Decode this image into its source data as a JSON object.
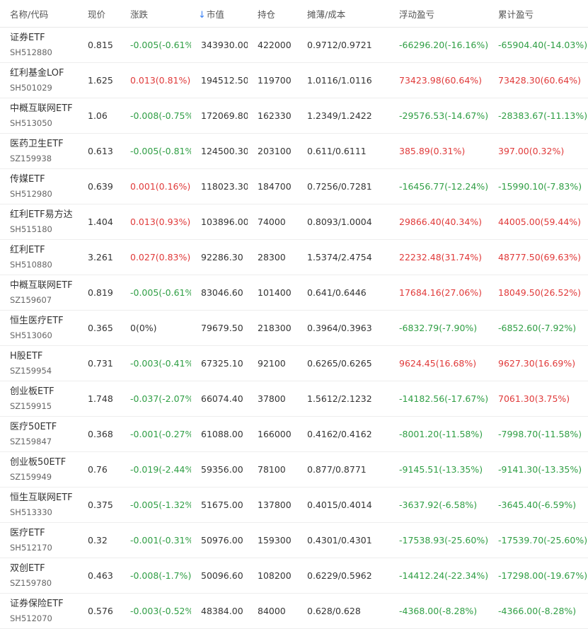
{
  "header": {
    "name": "名称/代码",
    "price": "现价",
    "change": "涨跌",
    "market_value": "市值",
    "market_value_sort_icon": "↓",
    "holding": "持仓",
    "cost": "摊薄/成本",
    "float_pl": "浮动盈亏",
    "total_pl": "累计盈亏"
  },
  "colors": {
    "up": "#e03a3a",
    "down": "#2f9e44",
    "sort_icon": "#3b82f6"
  },
  "rows": [
    {
      "name": "证券ETF",
      "code": "SH512880",
      "price": "0.815",
      "change": "-0.005(-0.61%)",
      "change_dir": "down",
      "market_value": "343930.00",
      "holding": "422000",
      "cost": "0.9712/0.9721",
      "float_pl": "-66296.20(-16.16%)",
      "float_dir": "down",
      "total_pl": "-65904.40(-14.03%)",
      "total_dir": "down"
    },
    {
      "name": "红利基金LOF",
      "code": "SH501029",
      "price": "1.625",
      "change": "0.013(0.81%)",
      "change_dir": "up",
      "market_value": "194512.50",
      "holding": "119700",
      "cost": "1.0116/1.0116",
      "float_pl": "73423.98(60.64%)",
      "float_dir": "up",
      "total_pl": "73428.30(60.64%)",
      "total_dir": "up"
    },
    {
      "name": "中概互联网ETF",
      "code": "SH513050",
      "price": "1.06",
      "change": "-0.008(-0.75%)",
      "change_dir": "down",
      "market_value": "172069.80",
      "holding": "162330",
      "cost": "1.2349/1.2422",
      "float_pl": "-29576.53(-14.67%)",
      "float_dir": "down",
      "total_pl": "-28383.67(-11.13%)",
      "total_dir": "down"
    },
    {
      "name": "医药卫生ETF",
      "code": "SZ159938",
      "price": "0.613",
      "change": "-0.005(-0.81%)",
      "change_dir": "down",
      "market_value": "124500.30",
      "holding": "203100",
      "cost": "0.611/0.6111",
      "float_pl": "385.89(0.31%)",
      "float_dir": "up",
      "total_pl": "397.00(0.32%)",
      "total_dir": "up"
    },
    {
      "name": "传媒ETF",
      "code": "SH512980",
      "price": "0.639",
      "change": "0.001(0.16%)",
      "change_dir": "up",
      "market_value": "118023.30",
      "holding": "184700",
      "cost": "0.7256/0.7281",
      "float_pl": "-16456.77(-12.24%)",
      "float_dir": "down",
      "total_pl": "-15990.10(-7.83%)",
      "total_dir": "down"
    },
    {
      "name": "红利ETF易方达",
      "code": "SH515180",
      "price": "1.404",
      "change": "0.013(0.93%)",
      "change_dir": "up",
      "market_value": "103896.00",
      "holding": "74000",
      "cost": "0.8093/1.0004",
      "float_pl": "29866.40(40.34%)",
      "float_dir": "up",
      "total_pl": "44005.00(59.44%)",
      "total_dir": "up"
    },
    {
      "name": "红利ETF",
      "code": "SH510880",
      "price": "3.261",
      "change": "0.027(0.83%)",
      "change_dir": "up",
      "market_value": "92286.30",
      "holding": "28300",
      "cost": "1.5374/2.4754",
      "float_pl": "22232.48(31.74%)",
      "float_dir": "up",
      "total_pl": "48777.50(69.63%)",
      "total_dir": "up"
    },
    {
      "name": "中概互联网ETF",
      "code": "SZ159607",
      "price": "0.819",
      "change": "-0.005(-0.61%)",
      "change_dir": "down",
      "market_value": "83046.60",
      "holding": "101400",
      "cost": "0.641/0.6446",
      "float_pl": "17684.16(27.06%)",
      "float_dir": "up",
      "total_pl": "18049.50(26.52%)",
      "total_dir": "up"
    },
    {
      "name": "恒生医疗ETF",
      "code": "SH513060",
      "price": "0.365",
      "change": "0(0%)",
      "change_dir": "flat",
      "market_value": "79679.50",
      "holding": "218300",
      "cost": "0.3964/0.3963",
      "float_pl": "-6832.79(-7.90%)",
      "float_dir": "down",
      "total_pl": "-6852.60(-7.92%)",
      "total_dir": "down"
    },
    {
      "name": "H股ETF",
      "code": "SZ159954",
      "price": "0.731",
      "change": "-0.003(-0.41%)",
      "change_dir": "down",
      "market_value": "67325.10",
      "holding": "92100",
      "cost": "0.6265/0.6265",
      "float_pl": "9624.45(16.68%)",
      "float_dir": "up",
      "total_pl": "9627.30(16.69%)",
      "total_dir": "up"
    },
    {
      "name": "创业板ETF",
      "code": "SZ159915",
      "price": "1.748",
      "change": "-0.037(-2.07%)",
      "change_dir": "down",
      "market_value": "66074.40",
      "holding": "37800",
      "cost": "1.5612/2.1232",
      "float_pl": "-14182.56(-17.67%)",
      "float_dir": "down",
      "total_pl": "7061.30(3.75%)",
      "total_dir": "up"
    },
    {
      "name": "医疗50ETF",
      "code": "SZ159847",
      "price": "0.368",
      "change": "-0.001(-0.27%)",
      "change_dir": "down",
      "market_value": "61088.00",
      "holding": "166000",
      "cost": "0.4162/0.4162",
      "float_pl": "-8001.20(-11.58%)",
      "float_dir": "down",
      "total_pl": "-7998.70(-11.58%)",
      "total_dir": "down"
    },
    {
      "name": "创业板50ETF",
      "code": "SZ159949",
      "price": "0.76",
      "change": "-0.019(-2.44%)",
      "change_dir": "down",
      "market_value": "59356.00",
      "holding": "78100",
      "cost": "0.877/0.8771",
      "float_pl": "-9145.51(-13.35%)",
      "float_dir": "down",
      "total_pl": "-9141.30(-13.35%)",
      "total_dir": "down"
    },
    {
      "name": "恒生互联网ETF",
      "code": "SH513330",
      "price": "0.375",
      "change": "-0.005(-1.32%)",
      "change_dir": "down",
      "market_value": "51675.00",
      "holding": "137800",
      "cost": "0.4015/0.4014",
      "float_pl": "-3637.92(-6.58%)",
      "float_dir": "down",
      "total_pl": "-3645.40(-6.59%)",
      "total_dir": "down"
    },
    {
      "name": "医疗ETF",
      "code": "SH512170",
      "price": "0.32",
      "change": "-0.001(-0.31%)",
      "change_dir": "down",
      "market_value": "50976.00",
      "holding": "159300",
      "cost": "0.4301/0.4301",
      "float_pl": "-17538.93(-25.60%)",
      "float_dir": "down",
      "total_pl": "-17539.70(-25.60%)",
      "total_dir": "down"
    },
    {
      "name": "双创ETF",
      "code": "SZ159780",
      "price": "0.463",
      "change": "-0.008(-1.7%)",
      "change_dir": "down",
      "market_value": "50096.60",
      "holding": "108200",
      "cost": "0.6229/0.5962",
      "float_pl": "-14412.24(-22.34%)",
      "float_dir": "down",
      "total_pl": "-17298.00(-19.67%)",
      "total_dir": "down"
    },
    {
      "name": "证券保险ETF",
      "code": "SH512070",
      "price": "0.576",
      "change": "-0.003(-0.52%)",
      "change_dir": "down",
      "market_value": "48384.00",
      "holding": "84000",
      "cost": "0.628/0.628",
      "float_pl": "-4368.00(-8.28%)",
      "float_dir": "down",
      "total_pl": "-4366.00(-8.28%)",
      "total_dir": "down"
    }
  ]
}
